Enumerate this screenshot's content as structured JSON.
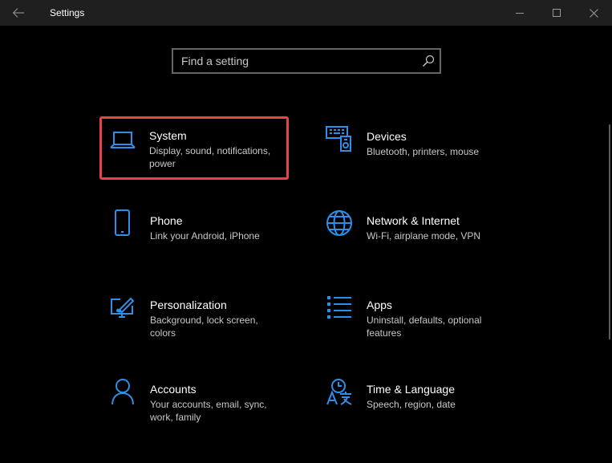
{
  "window": {
    "title": "Settings"
  },
  "search": {
    "placeholder": "Find a setting"
  },
  "tiles": [
    {
      "label": "System",
      "desc": "Display, sound, notifications, power",
      "icon": "laptop-icon",
      "selected": true
    },
    {
      "label": "Devices",
      "desc": "Bluetooth, printers, mouse",
      "icon": "devices-icon"
    },
    {
      "label": "Phone",
      "desc": "Link your Android, iPhone",
      "icon": "phone-icon"
    },
    {
      "label": "Network & Internet",
      "desc": "Wi-Fi, airplane mode, VPN",
      "icon": "globe-icon"
    },
    {
      "label": "Personalization",
      "desc": "Background, lock screen, colors",
      "icon": "paint-icon"
    },
    {
      "label": "Apps",
      "desc": "Uninstall, defaults, optional features",
      "icon": "apps-list-icon"
    },
    {
      "label": "Accounts",
      "desc": "Your accounts, email, sync, work, family",
      "icon": "person-icon"
    },
    {
      "label": "Time & Language",
      "desc": "Speech, region, date",
      "icon": "time-language-icon"
    }
  ],
  "colors": {
    "accent": "#2f8fe8",
    "selection_border": "#e8434b",
    "titlebar": "#1f1f1f"
  }
}
